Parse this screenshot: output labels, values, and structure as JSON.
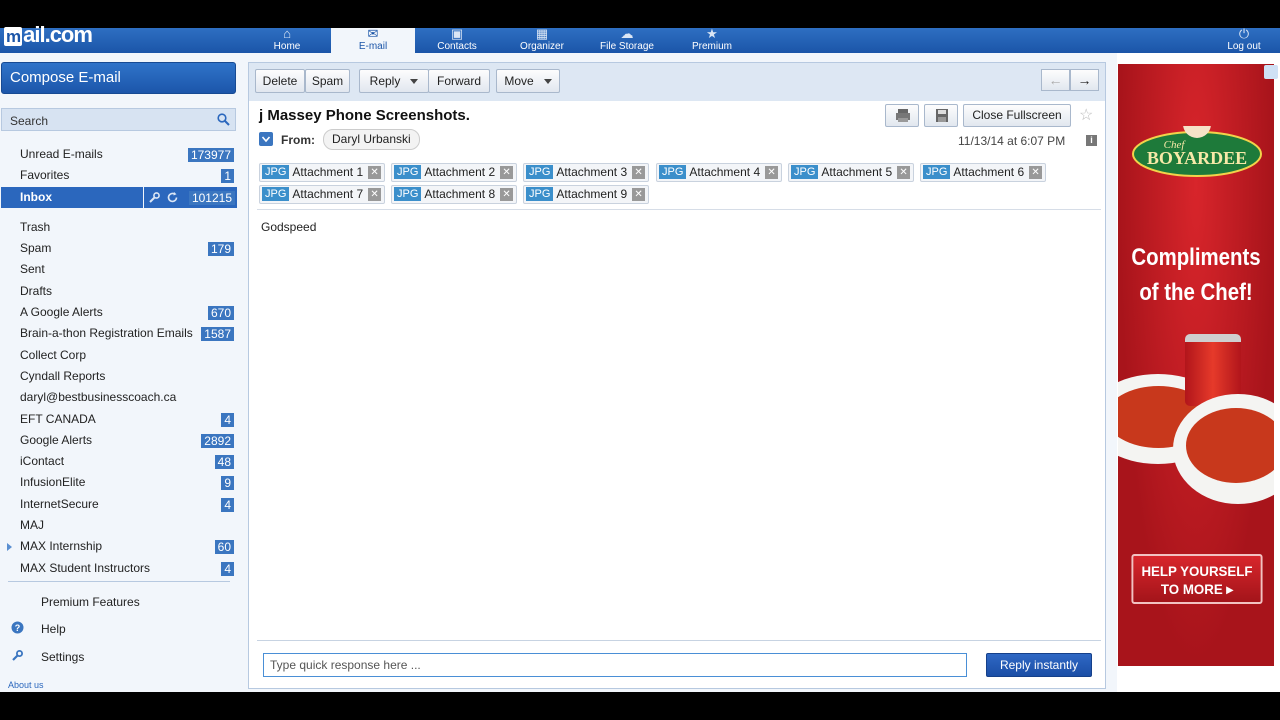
{
  "brand": {
    "logo": "mail.com"
  },
  "nav": [
    {
      "label": "Home",
      "icon": "home-icon"
    },
    {
      "label": "E-mail",
      "icon": "mail-icon"
    },
    {
      "label": "Contacts",
      "icon": "contacts-icon"
    },
    {
      "label": "Organizer",
      "icon": "calendar-icon"
    },
    {
      "label": "File Storage",
      "icon": "cloud-icon"
    },
    {
      "label": "Premium",
      "icon": "star-icon"
    },
    {
      "label": "Log out",
      "icon": "power-icon"
    }
  ],
  "sidebar": {
    "compose": "Compose E-mail",
    "search_placeholder": "Search",
    "folders": [
      {
        "label": "Unread E-mails",
        "count": "173977"
      },
      {
        "label": "Favorites",
        "count": "1"
      },
      {
        "label": "Inbox",
        "count": "101215"
      },
      {
        "label": "Trash",
        "count": ""
      },
      {
        "label": "Spam",
        "count": "179"
      },
      {
        "label": "Sent",
        "count": ""
      },
      {
        "label": "Drafts",
        "count": ""
      },
      {
        "label": "A Google Alerts",
        "count": "670"
      },
      {
        "label": "Brain-a-thon Registration Emails",
        "count": "1587"
      },
      {
        "label": "Collect Corp",
        "count": ""
      },
      {
        "label": "Cyndall Reports",
        "count": ""
      },
      {
        "label": "daryl@bestbusinesscoach.ca",
        "count": ""
      },
      {
        "label": "EFT CANADA",
        "count": "4"
      },
      {
        "label": "Google Alerts",
        "count": "2892"
      },
      {
        "label": "iContact",
        "count": "48"
      },
      {
        "label": "InfusionElite",
        "count": "9"
      },
      {
        "label": "InternetSecure",
        "count": "4"
      },
      {
        "label": "MAJ",
        "count": ""
      },
      {
        "label": "MAX Internship",
        "count": "60"
      },
      {
        "label": "MAX Student Instructors",
        "count": "4"
      }
    ],
    "premium": "Premium Features",
    "help": "Help",
    "settings": "Settings",
    "about": "About us"
  },
  "toolbar": {
    "delete": "Delete",
    "spam": "Spam",
    "reply": "Reply",
    "forward": "Forward",
    "move": "Move"
  },
  "message": {
    "subject": "j Massey Phone Screenshots.",
    "close_fullscreen": "Close Fullscreen",
    "from_label": "From:",
    "sender": "Daryl Urbanski",
    "date": "11/13/14 at 6:07 PM",
    "attachment_type": "JPG",
    "attachments": [
      "Attachment 1",
      "Attachment 2",
      "Attachment 3",
      "Attachment 4",
      "Attachment 5",
      "Attachment 6",
      "Attachment 7",
      "Attachment 8",
      "Attachment 9"
    ],
    "body": "Godspeed"
  },
  "quick_reply": {
    "placeholder": "Type quick response here ...",
    "button": "Reply instantly"
  },
  "ad": {
    "brand": "Chef BOYARDEE",
    "headline_1": "Compliments",
    "headline_2": "of the Chef!",
    "cta_1": "HELP YOURSELF",
    "cta_2": "TO MORE ▸"
  },
  "colors": {
    "brand_blue": "#1b55a8",
    "accent": "#2b67bd",
    "ad_red": "#c4161c"
  }
}
